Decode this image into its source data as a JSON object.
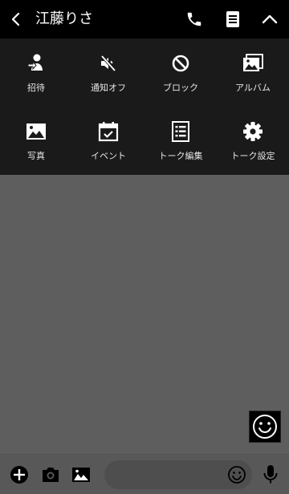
{
  "header": {
    "title": "江藤りさ",
    "icons": [
      "back-icon",
      "phone-icon",
      "notes-icon",
      "chevron-up-icon"
    ]
  },
  "menu": {
    "items": [
      {
        "label": "招待",
        "icon": "invite-icon"
      },
      {
        "label": "通知オフ",
        "icon": "mute-icon"
      },
      {
        "label": "ブロック",
        "icon": "block-icon"
      },
      {
        "label": "アルバム",
        "icon": "album-icon"
      },
      {
        "label": "写真",
        "icon": "photo-icon"
      },
      {
        "label": "イベント",
        "icon": "event-icon"
      },
      {
        "label": "トーク編集",
        "icon": "edit-talk-icon"
      },
      {
        "label": "トーク設定",
        "icon": "settings-icon"
      }
    ]
  },
  "composer": {
    "placeholder": "",
    "icons": [
      "plus-icon",
      "camera-icon",
      "image-icon",
      "emoji-icon",
      "microphone-icon"
    ]
  },
  "colors": {
    "header_bg": "#000000",
    "menu_bg": "#1a1a1a",
    "chat_bg": "#5e5e5e",
    "bottom_bar_bg": "#585858",
    "icon": "#ffffff"
  }
}
